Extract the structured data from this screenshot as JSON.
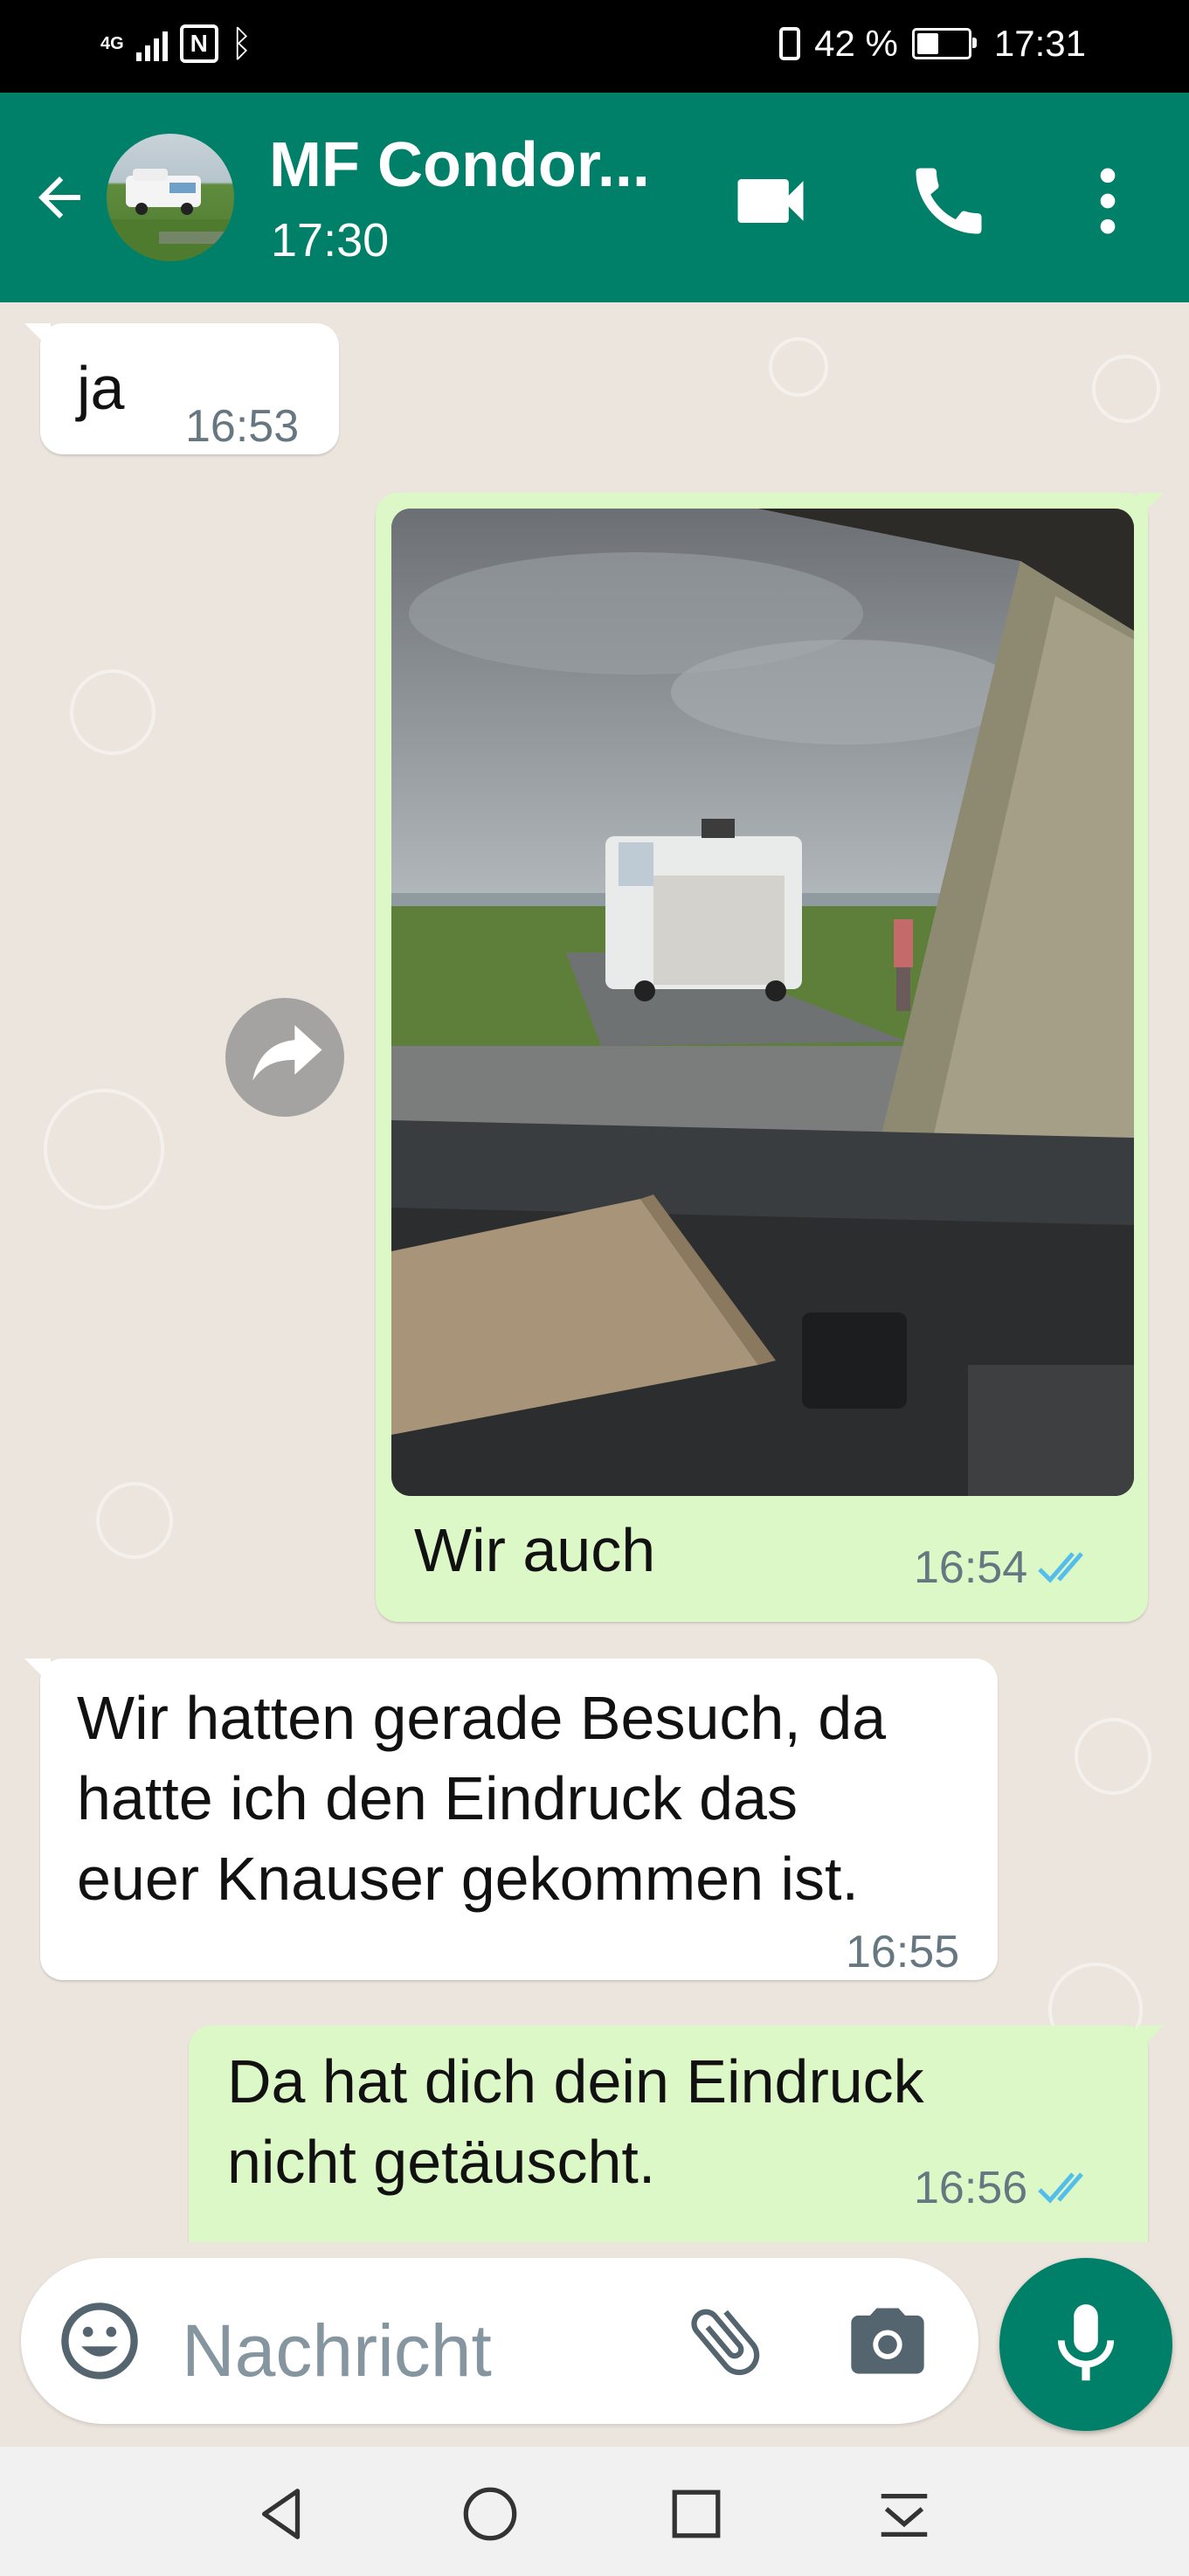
{
  "status_bar": {
    "network": "4G",
    "battery": "42 %",
    "time": "17:31"
  },
  "header": {
    "title": "MF Condor...",
    "subtitle": "17:30",
    "icons": [
      "back-arrow-icon",
      "video-call-icon",
      "phone-icon",
      "more-vert-icon"
    ]
  },
  "messages": [
    {
      "direction": "incoming",
      "text": "ja",
      "time": "16:53"
    },
    {
      "direction": "outgoing",
      "type": "image",
      "caption": "Wir auch",
      "time": "16:54",
      "status": "read"
    },
    {
      "direction": "incoming",
      "lines": [
        "Wir hatten gerade Besuch, da",
        "hatte ich den Eindruck das",
        "euer Knauser gekommen ist."
      ],
      "time": "16:55"
    },
    {
      "direction": "outgoing",
      "lines": [
        "Da hat dich dein Eindruck",
        "nicht getäuscht."
      ],
      "time": "16:56",
      "status": "read"
    }
  ],
  "composer": {
    "placeholder": "Nachricht",
    "icons": [
      "emoji-icon",
      "attach-icon",
      "camera-icon",
      "mic-icon"
    ]
  },
  "colors": {
    "header": "#008069",
    "chat_background": "#ece5dd",
    "outgoing_bubble": "#dcf8c6",
    "incoming_bubble": "#ffffff",
    "read_ticks": "#53bdeb"
  }
}
